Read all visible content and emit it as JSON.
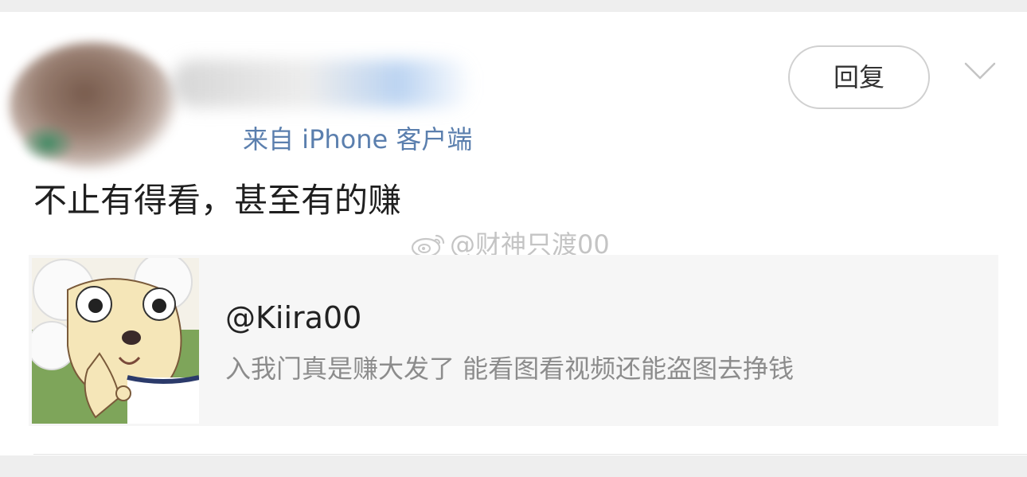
{
  "post": {
    "source": "来自 iPhone 客户端",
    "reply_label": "回复",
    "body": "不止有得看，甚至有的赚"
  },
  "watermark": {
    "text": "@财神只渡00"
  },
  "quote": {
    "username": "@Kiira00",
    "text": "入我门真是赚大发了 能看图看视频还能盗图去挣钱"
  },
  "icons": {
    "chevron": "chevron-down-icon",
    "weibo": "weibo-logo-icon"
  },
  "colors": {
    "source_blue": "#5b7fae",
    "background": "#eeeeee",
    "quote_bg": "#f6f6f6"
  }
}
